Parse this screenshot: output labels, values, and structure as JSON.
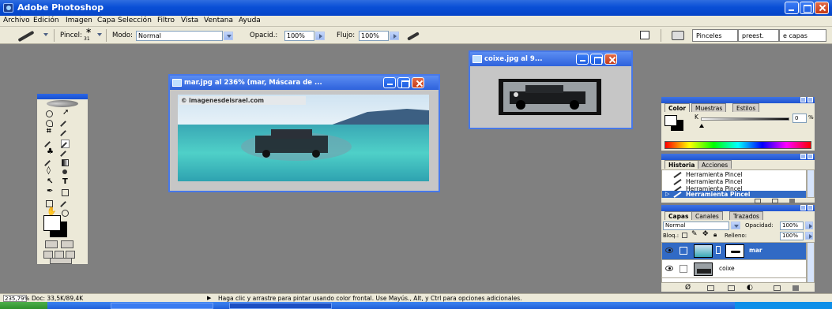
{
  "window": {
    "title": "Adobe Photoshop"
  },
  "menu": [
    "Archivo",
    "Edición",
    "Imagen",
    "Capa",
    "Selección",
    "Filtro",
    "Vista",
    "Ventana",
    "Ayuda"
  ],
  "options": {
    "brush_label": "Pincel:",
    "brush_size": "31",
    "mode_label": "Modo:",
    "mode_value": "Normal",
    "opacity_label": "Opacid.:",
    "opacity_value": "100%",
    "flow_label": "Flujo:",
    "flow_value": "100%",
    "well_tabs": [
      "Pinceles",
      "preest.",
      "e capas"
    ]
  },
  "documents": [
    {
      "title": "mar.jpg al 236% (mar, Máscara de ...",
      "watermark": "© imagenesdeisrael.com"
    },
    {
      "title": "coixe.jpg al 9..."
    }
  ],
  "color_palette": {
    "tabs": [
      "Color",
      "Muestras",
      "Estilos"
    ],
    "channel_label": "K",
    "channel_value": "0",
    "unit": "%",
    "k_fraction": 0.0
  },
  "history_palette": {
    "tabs": [
      "Historia",
      "Acciones"
    ],
    "items": [
      "Herramienta Pincel",
      "Herramienta Pincel",
      "Herramienta Pincel",
      "Herramienta Pincel"
    ],
    "selected_index": 3
  },
  "layers_palette": {
    "tabs": [
      "Capas",
      "Canales",
      "Trazados"
    ],
    "blend_mode": "Normal",
    "opacity_label": "Opacidad:",
    "opacity_value": "100%",
    "lock_label": "Bloq.:",
    "fill_label": "Relleno:",
    "fill_value": "100%",
    "layers": [
      {
        "name": "mar",
        "selected": true
      },
      {
        "name": "coixe",
        "selected": false
      }
    ]
  },
  "status": {
    "zoom": "235,79%",
    "doc_info": "Doc: 33,5K/89,4K",
    "hint": "Haga clic y arrastre para pintar usando color frontal. Use Mayús., Alt, y Ctrl para opciones adicionales."
  },
  "colors": {
    "xp_blue": "#0a4fd6",
    "workspace": "#808080",
    "selected_row": "#316ac5"
  }
}
